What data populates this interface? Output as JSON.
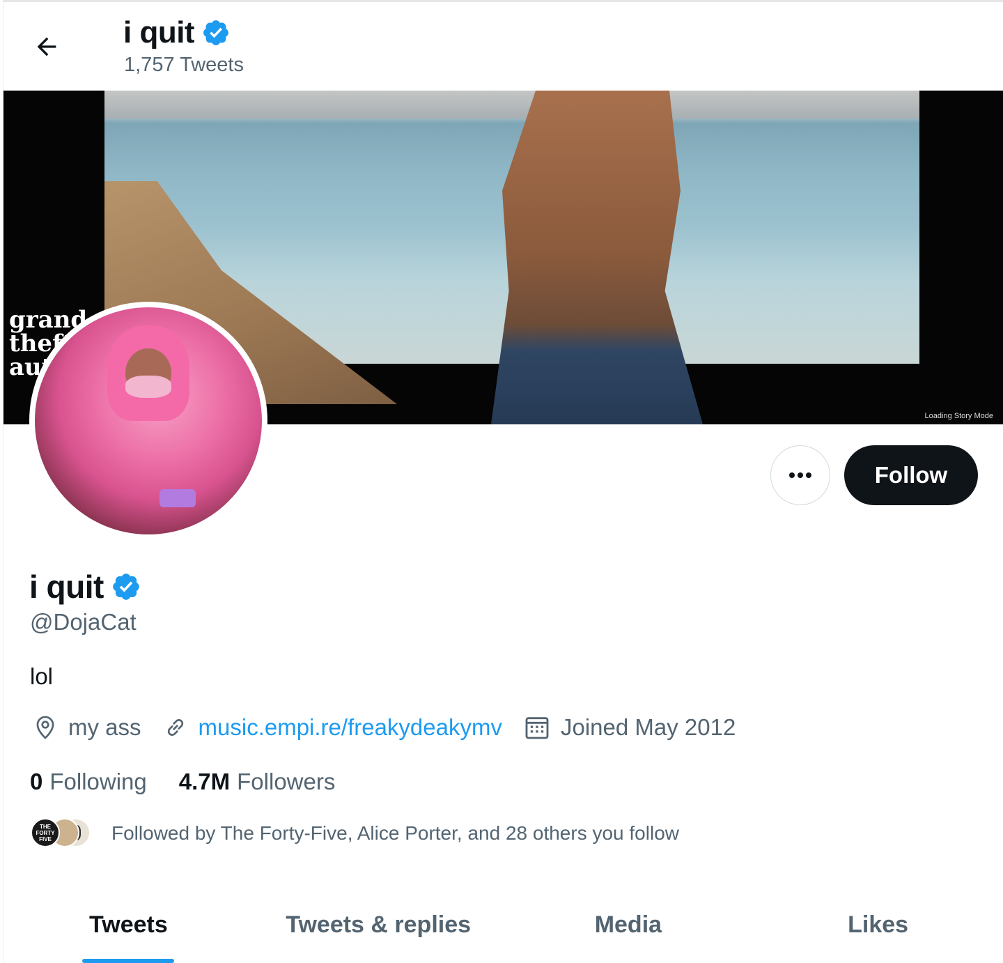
{
  "header": {
    "title": "i quit",
    "tweet_count": "1,757 Tweets"
  },
  "banner": {
    "overlay_text": "grand theft auto",
    "loading_text": "Loading Story Mode"
  },
  "actions": {
    "follow_label": "Follow"
  },
  "profile": {
    "display_name": "i quit",
    "handle": "@DojaCat",
    "bio": "lol",
    "location": "my ass",
    "website": "music.empi.re/freakydeakymv",
    "joined": "Joined May 2012",
    "following_count": "0",
    "following_label": "Following",
    "followers_count": "4.7M",
    "followers_label": "Followers",
    "followed_by": "Followed by The Forty-Five, Alice Porter, and 28 others you follow",
    "followed_by_avatar_text": "THE FORTY FIVE"
  },
  "tabs": [
    {
      "label": "Tweets",
      "active": true
    },
    {
      "label": "Tweets & replies",
      "active": false
    },
    {
      "label": "Media",
      "active": false
    },
    {
      "label": "Likes",
      "active": false
    }
  ],
  "colors": {
    "accent": "#1d9bf0",
    "text_primary": "#0f1419",
    "text_secondary": "#536471",
    "follow_button_bg": "#0f1419"
  },
  "icons": {
    "back": "arrow-left-icon",
    "verified": "verified-badge-icon",
    "more": "more-dots-icon",
    "location": "location-pin-icon",
    "link": "link-icon",
    "calendar": "calendar-icon"
  }
}
